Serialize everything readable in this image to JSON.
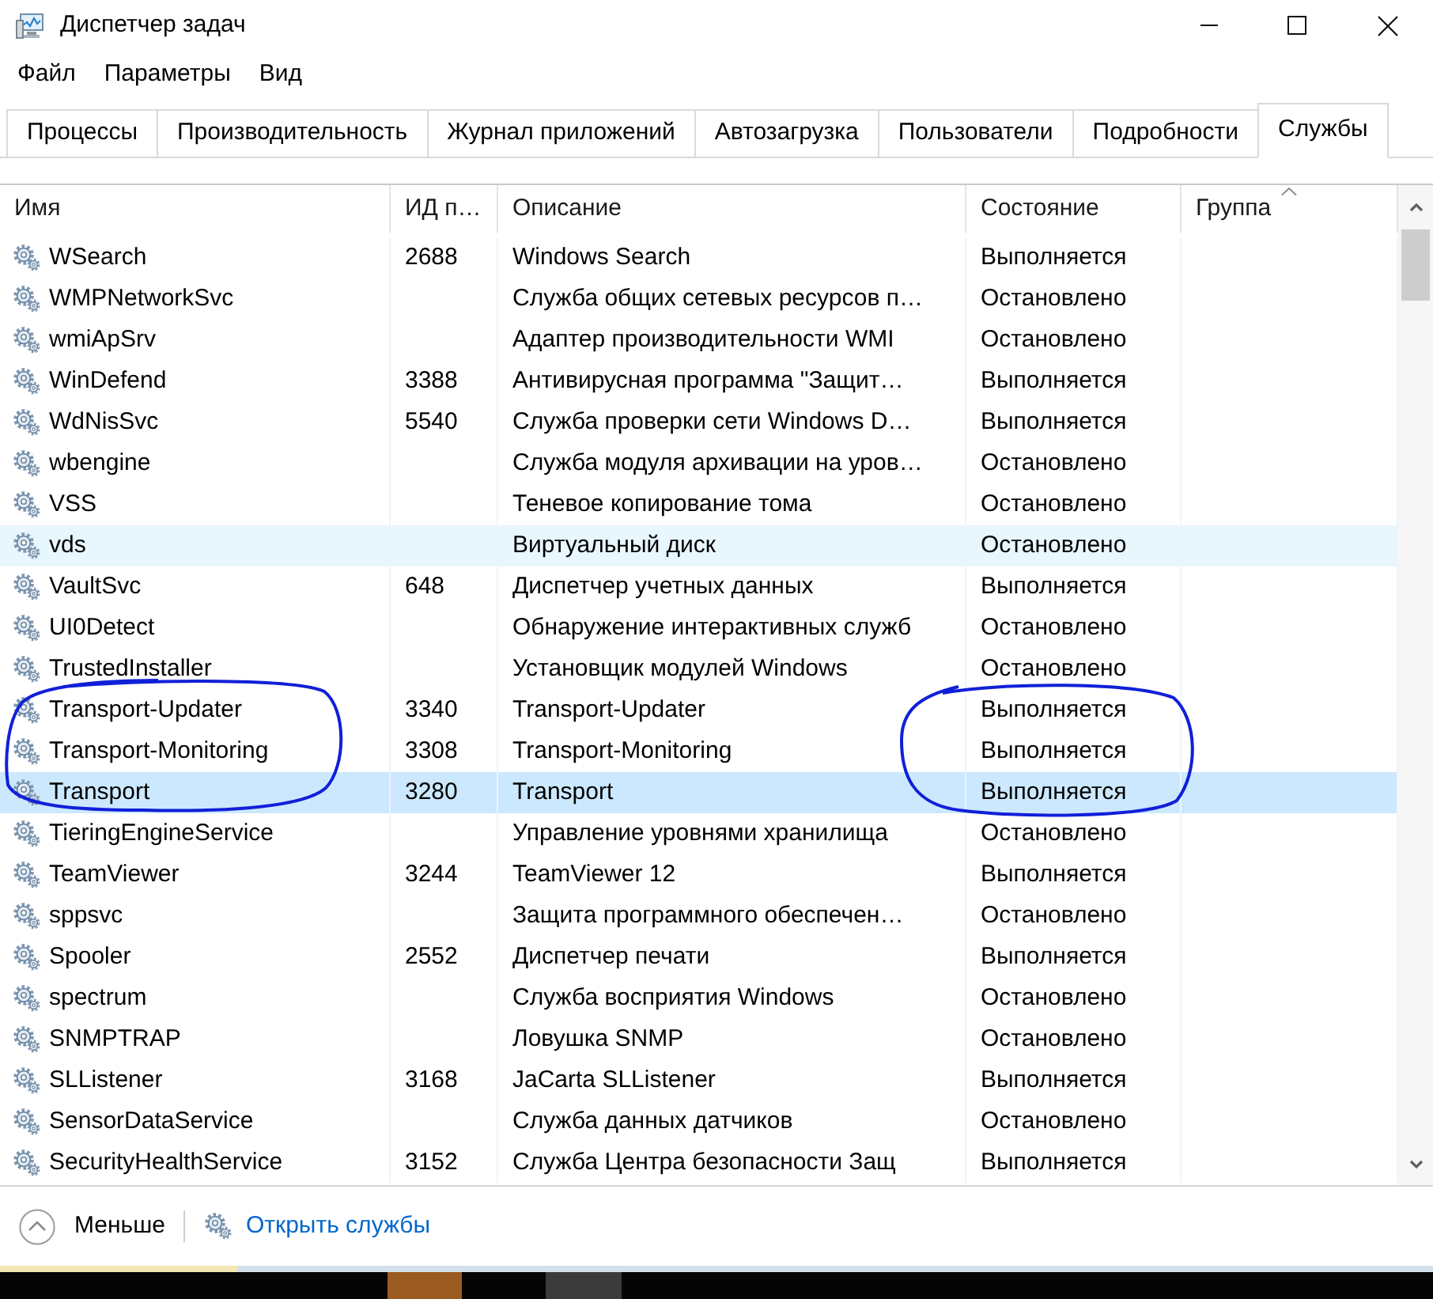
{
  "window": {
    "title": "Диспетчер задач"
  },
  "menu": [
    {
      "label": "Файл"
    },
    {
      "label": "Параметры"
    },
    {
      "label": "Вид"
    }
  ],
  "tabs": [
    {
      "label": "Процессы",
      "selected": false
    },
    {
      "label": "Производительность",
      "selected": false
    },
    {
      "label": "Журнал приложений",
      "selected": false
    },
    {
      "label": "Автозагрузка",
      "selected": false
    },
    {
      "label": "Пользователи",
      "selected": false
    },
    {
      "label": "Подробности",
      "selected": false
    },
    {
      "label": "Службы",
      "selected": true
    }
  ],
  "table": {
    "columns": [
      {
        "label": "Имя",
        "sorted": false
      },
      {
        "label": "ИД п…",
        "sorted": false
      },
      {
        "label": "Описание",
        "sorted": false
      },
      {
        "label": "Состояние",
        "sorted": false
      },
      {
        "label": "Группа",
        "sorted": true
      }
    ],
    "rows": [
      {
        "name": "WSearch",
        "pid": "2688",
        "description": "Windows Search",
        "status": "Выполняется",
        "selected": false,
        "hovered": false
      },
      {
        "name": "WMPNetworkSvc",
        "description": "Служба общих сетевых ресурсов п…",
        "status": "Остановлено",
        "selected": false,
        "hovered": false
      },
      {
        "name": "wmiApSrv",
        "description": "Адаптер производительности WMI",
        "status": "Остановлено",
        "selected": false,
        "hovered": false
      },
      {
        "name": "WinDefend",
        "pid": "3388",
        "description": "Антивирусная программа \"Защит…",
        "status": "Выполняется",
        "selected": false,
        "hovered": false
      },
      {
        "name": "WdNisSvc",
        "pid": "5540",
        "description": "Служба проверки сети Windows D…",
        "status": "Выполняется",
        "selected": false,
        "hovered": false
      },
      {
        "name": "wbengine",
        "description": "Служба модуля архивации на уров…",
        "status": "Остановлено",
        "selected": false,
        "hovered": false
      },
      {
        "name": "VSS",
        "description": "Теневое копирование тома",
        "status": "Остановлено",
        "selected": false,
        "hovered": false
      },
      {
        "name": "vds",
        "description": "Виртуальный диск",
        "status": "Остановлено",
        "selected": false,
        "hovered": true
      },
      {
        "name": "VaultSvc",
        "pid": "648",
        "description": "Диспетчер учетных данных",
        "status": "Выполняется",
        "selected": false,
        "hovered": false
      },
      {
        "name": "UI0Detect",
        "description": "Обнаружение интерактивных служб",
        "status": "Остановлено",
        "selected": false,
        "hovered": false
      },
      {
        "name": "TrustedInstaller",
        "description": "Установщик модулей Windows",
        "status": "Остановлено",
        "selected": false,
        "hovered": false
      },
      {
        "name": "Transport-Updater",
        "pid": "3340",
        "description": "Transport-Updater",
        "status": "Выполняется",
        "selected": false,
        "hovered": false
      },
      {
        "name": "Transport-Monitoring",
        "pid": "3308",
        "description": "Transport-Monitoring",
        "status": "Выполняется",
        "selected": false,
        "hovered": false
      },
      {
        "name": "Transport",
        "pid": "3280",
        "description": "Transport",
        "status": "Выполняется",
        "selected": true,
        "hovered": false
      },
      {
        "name": "TieringEngineService",
        "description": "Управление уровнями хранилища",
        "status": "Остановлено",
        "selected": false,
        "hovered": false
      },
      {
        "name": "TeamViewer",
        "pid": "3244",
        "description": "TeamViewer 12",
        "status": "Выполняется",
        "selected": false,
        "hovered": false
      },
      {
        "name": "sppsvc",
        "description": "Защита программного обеспечен…",
        "status": "Остановлено",
        "selected": false,
        "hovered": false
      },
      {
        "name": "Spooler",
        "pid": "2552",
        "description": "Диспетчер печати",
        "status": "Выполняется",
        "selected": false,
        "hovered": false
      },
      {
        "name": "spectrum",
        "description": "Служба восприятия Windows",
        "status": "Остановлено",
        "selected": false,
        "hovered": false
      },
      {
        "name": "SNMPTRAP",
        "description": "Ловушка SNMP",
        "status": "Остановлено",
        "selected": false,
        "hovered": false
      },
      {
        "name": "SLListener",
        "pid": "3168",
        "description": "JaCarta SLListener",
        "status": "Выполняется",
        "selected": false,
        "hovered": false
      },
      {
        "name": "SensorDataService",
        "description": "Служба данных датчиков",
        "status": "Остановлено",
        "selected": false,
        "hovered": false
      },
      {
        "name": "SecurityHealthService",
        "pid": "3152",
        "description": "Служба Центра безопасности Защ",
        "status": "Выполняется",
        "selected": false,
        "hovered": false
      }
    ]
  },
  "footer": {
    "less_button": "Меньше",
    "open_services_link": "Открыть службы"
  }
}
